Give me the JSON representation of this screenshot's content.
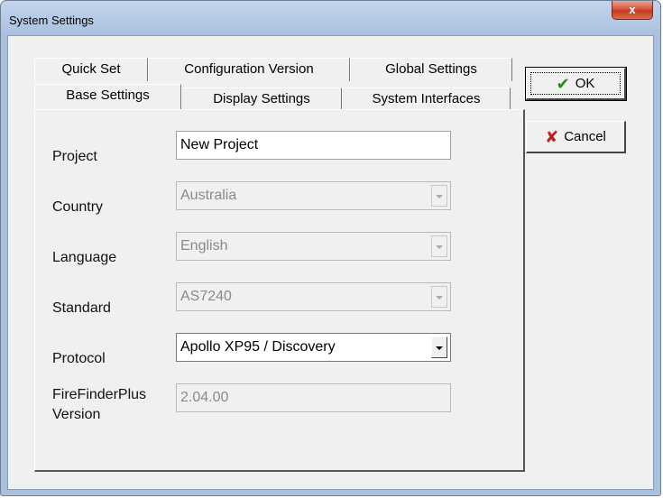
{
  "window": {
    "title": "System Settings",
    "close_label": "x"
  },
  "tabs": {
    "row_back": [
      {
        "label": "Quick Set"
      },
      {
        "label": "Configuration Version"
      },
      {
        "label": "Global Settings"
      }
    ],
    "row_front": [
      {
        "label": "Base Settings",
        "active": true
      },
      {
        "label": "Display Settings"
      },
      {
        "label": "System Interfaces"
      }
    ]
  },
  "fields": {
    "project": {
      "label": "Project",
      "value": "New Project"
    },
    "country": {
      "label": "Country",
      "value": "Australia"
    },
    "language": {
      "label": "Language",
      "value": "English"
    },
    "standard": {
      "label": "Standard",
      "value": "AS7240"
    },
    "protocol": {
      "label": "Protocol",
      "value": "Apollo XP95 / Discovery"
    },
    "version": {
      "label_line1": "FireFinderPlus",
      "label_line2": "Version",
      "value": "2.04.00"
    }
  },
  "buttons": {
    "ok": {
      "label": "OK",
      "icon": "check-icon"
    },
    "cancel": {
      "label": "Cancel",
      "icon": "x-icon"
    }
  },
  "colors": {
    "ok_icon": "#2a8a1a",
    "cancel_icon": "#c0201a",
    "close_button": "#c9452a"
  }
}
